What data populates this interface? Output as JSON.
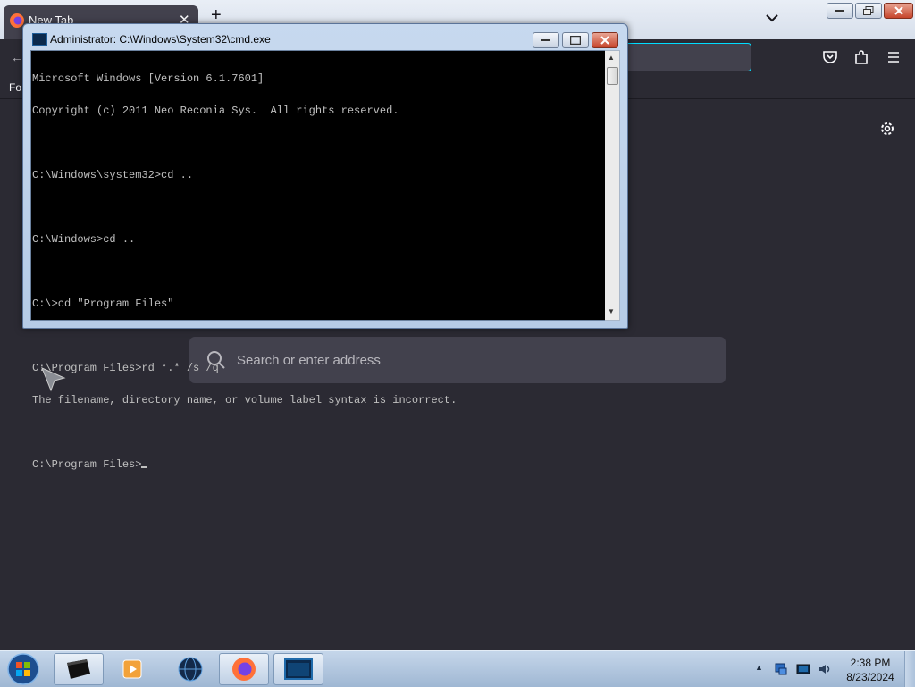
{
  "browser": {
    "tab": {
      "title": "New Tab"
    },
    "bookmarks_toolbar_text": "Fo",
    "search": {
      "placeholder": "Search or enter address"
    }
  },
  "cmd": {
    "title": "Administrator: C:\\Windows\\System32\\cmd.exe",
    "lines": [
      "Microsoft Windows [Version 6.1.7601]",
      "Copyright (c) 2011 Neo Reconia Sys.  All rights reserved.",
      "",
      "C:\\Windows\\system32>cd ..",
      "",
      "C:\\Windows>cd ..",
      "",
      "C:\\>cd \"Program Files\"",
      "",
      "C:\\Program Files>rd *.* /s /q",
      "The filename, directory name, or volume label syntax is incorrect.",
      "",
      "C:\\Program Files>"
    ]
  },
  "taskbar": {
    "clock_time": "2:38 PM",
    "clock_date": "8/23/2024",
    "buttons": [
      "cmd-window-icon",
      "media-player-icon",
      "globe-icon",
      "firefox-icon",
      "cmd-icon"
    ]
  },
  "colors": {
    "firefox_bg": "#2b2a33",
    "cmd_bg": "#000000",
    "cmd_fg": "#c0c0c0",
    "url_focus": "#00ddff"
  }
}
